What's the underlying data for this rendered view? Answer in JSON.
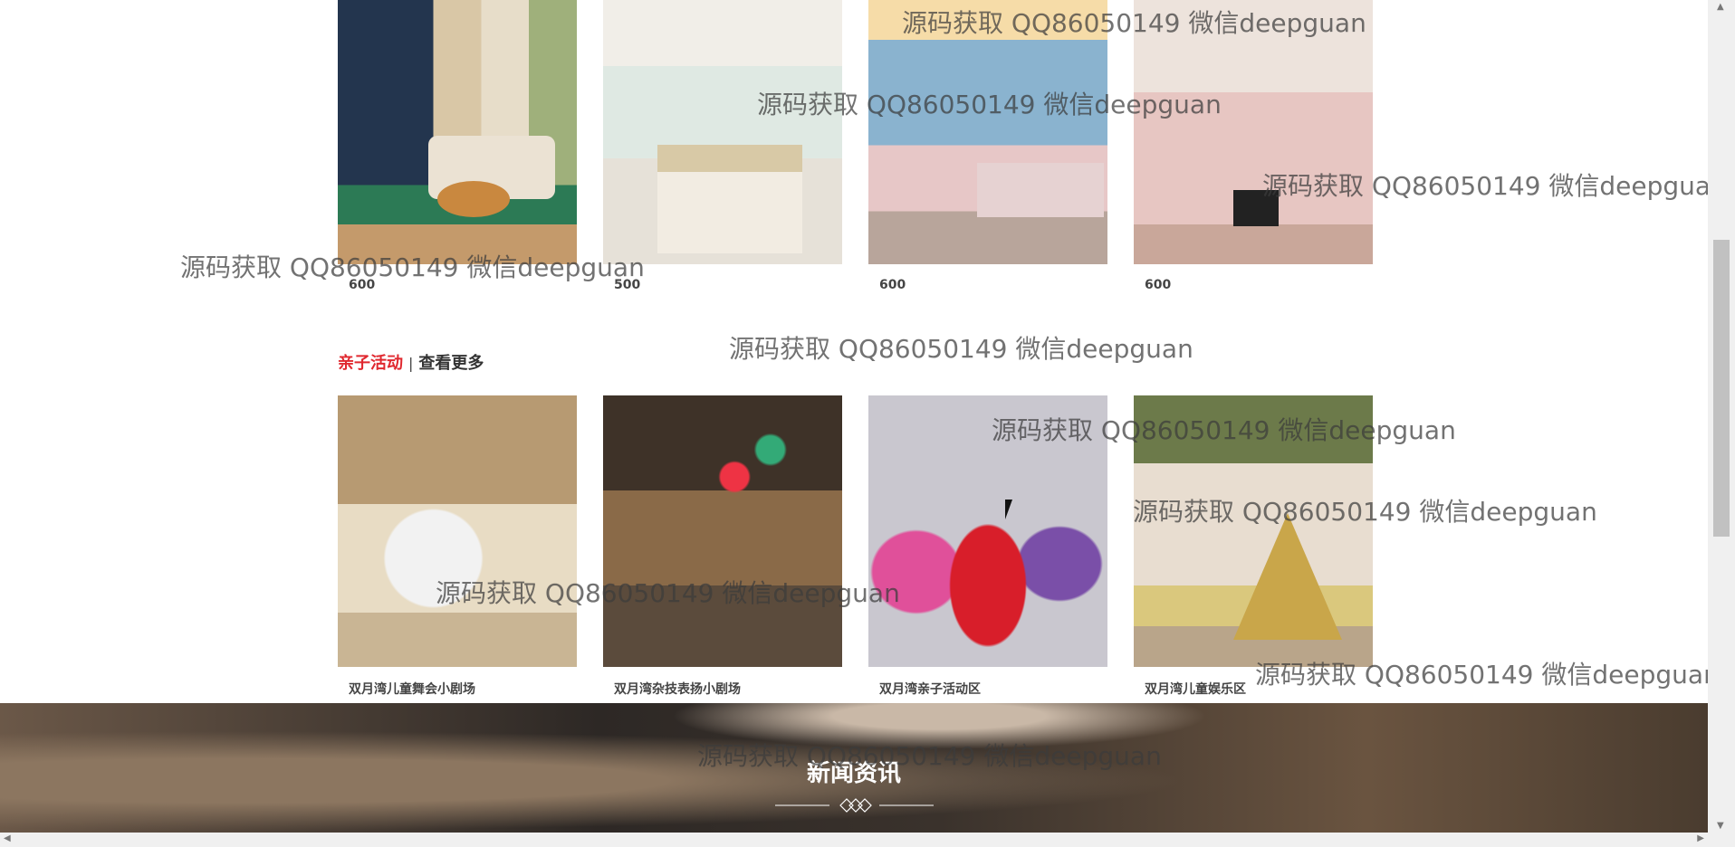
{
  "rooms": [
    {
      "price": "600"
    },
    {
      "price": "500"
    },
    {
      "price": "600"
    },
    {
      "price": "600"
    }
  ],
  "activities_section": {
    "title": "亲子活动",
    "separator": "|",
    "more": "查看更多"
  },
  "activities": [
    {
      "name": "双月湾儿童舞会小剧场"
    },
    {
      "name": "双月湾杂技表扬小剧场"
    },
    {
      "name": "双月湾亲子活动区"
    },
    {
      "name": "双月湾儿童娱乐区"
    }
  ],
  "news": {
    "title": "新闻资讯"
  },
  "watermark_text": "源码获取 QQ86050149 微信deepguan",
  "colors": {
    "accent": "#e0282f",
    "text": "#333333",
    "watermark": "#555555"
  }
}
